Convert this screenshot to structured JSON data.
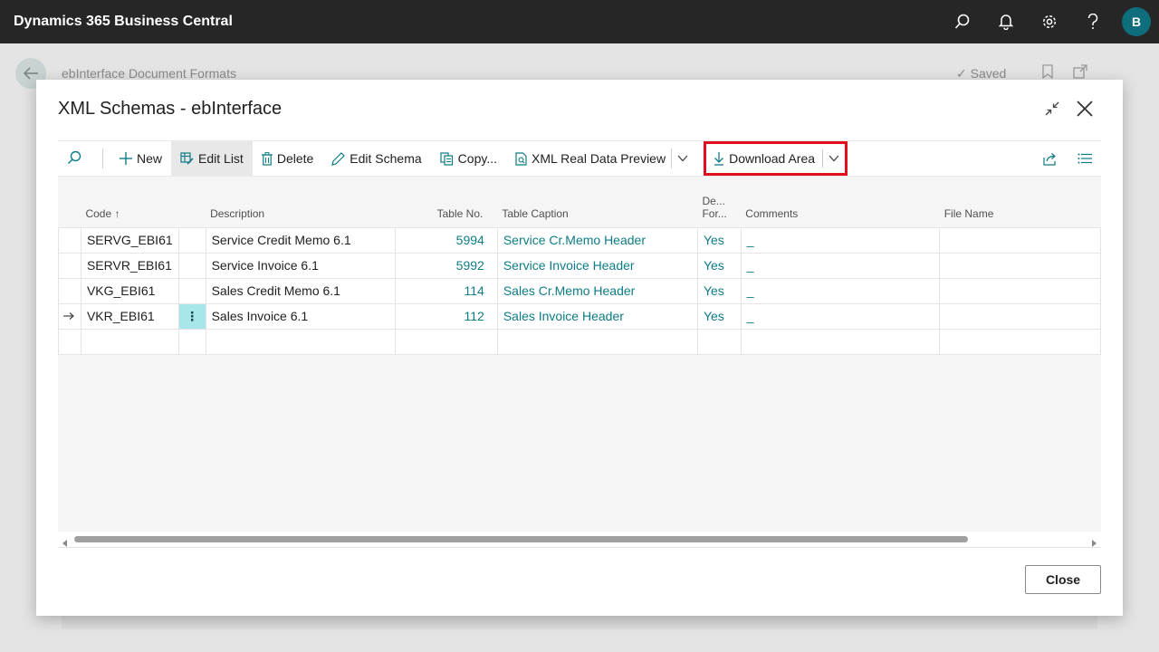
{
  "app": {
    "title": "Dynamics 365 Business Central",
    "avatar_initial": "B"
  },
  "background_page": {
    "title": "ebInterface Document Formats",
    "saved_label": "Saved"
  },
  "dialog": {
    "title": "XML Schemas - ebInterface",
    "close_button": "Close"
  },
  "actions": {
    "new": "New",
    "edit_list": "Edit List",
    "delete": "Delete",
    "edit_schema": "Edit Schema",
    "copy": "Copy...",
    "xml_preview": "XML Real Data Preview",
    "download_area": "Download Area"
  },
  "columns": {
    "code": "Code",
    "description": "Description",
    "table_no": "Table No.",
    "table_caption": "Table Caption",
    "default_format_1": "De...",
    "default_format_2": "For...",
    "comments": "Comments",
    "file_name": "File Name"
  },
  "rows": [
    {
      "code": "SERVG_EBI61",
      "description": "Service Credit Memo 6.1",
      "table_no": "5994",
      "table_caption": "Service Cr.Memo Header",
      "default": "Yes",
      "comments": "_"
    },
    {
      "code": "SERVR_EBI61",
      "description": "Service Invoice 6.1",
      "table_no": "5992",
      "table_caption": "Service Invoice Header",
      "default": "Yes",
      "comments": "_"
    },
    {
      "code": "VKG_EBI61",
      "description": "Sales Credit Memo 6.1",
      "table_no": "114",
      "table_caption": "Sales Cr.Memo Header",
      "default": "Yes",
      "comments": "_"
    },
    {
      "code": "VKR_EBI61",
      "description": "Sales Invoice 6.1",
      "table_no": "112",
      "table_caption": "Sales Invoice Header",
      "default": "Yes",
      "comments": "_"
    }
  ],
  "colors": {
    "accent": "#0e7c86",
    "highlight_box": "#e0101e",
    "appbar": "#262626"
  }
}
